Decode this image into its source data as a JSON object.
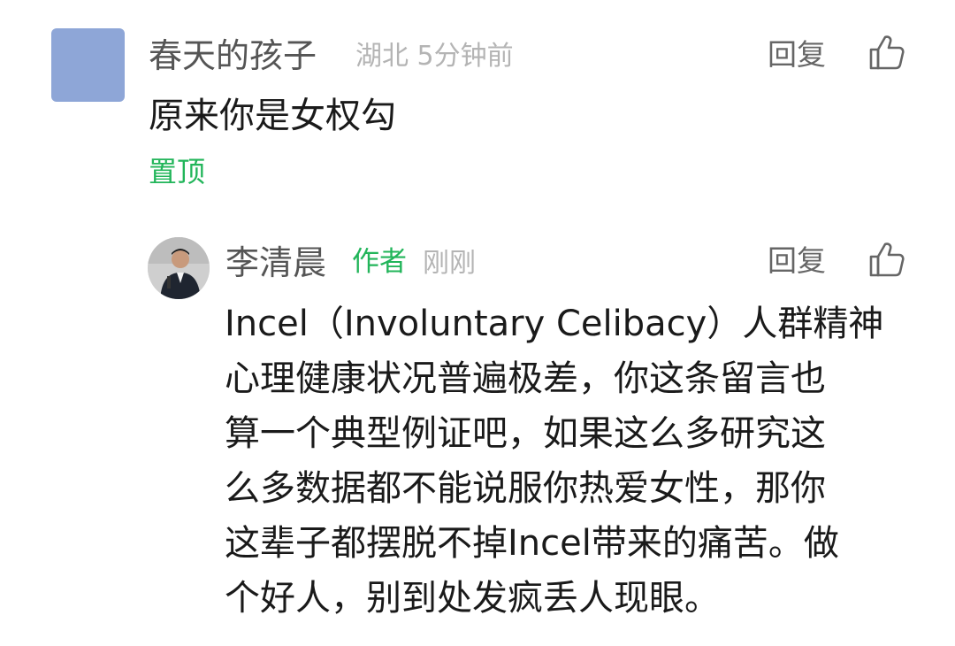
{
  "comment": {
    "username": "春天的孩子",
    "location": "湖北",
    "time": "5分钟前",
    "text": "原来你是女权勾",
    "pin_label": "置顶",
    "reply_label": "回复"
  },
  "reply": {
    "username": "李清晨",
    "author_badge": "作者",
    "time": "刚刚",
    "reply_label": "回复",
    "text_lines": [
      "Incel（Involuntary Celibacy）人群精神",
      "心理健康状况普遍极差，你这条留言也",
      "算一个典型例证吧，如果这么多研究这",
      "么多数据都不能说服你热爱女性，那你",
      "这辈子都摆脱不掉Incel带来的痛苦。做",
      "个好人，别到处发疯丢人现眼。"
    ]
  },
  "colors": {
    "accent_green": "#22b55a",
    "avatar_blue": "#8ea6d7",
    "meta_gray": "#b4b4b4"
  },
  "icons": {
    "like": "thumbs-up-icon"
  }
}
